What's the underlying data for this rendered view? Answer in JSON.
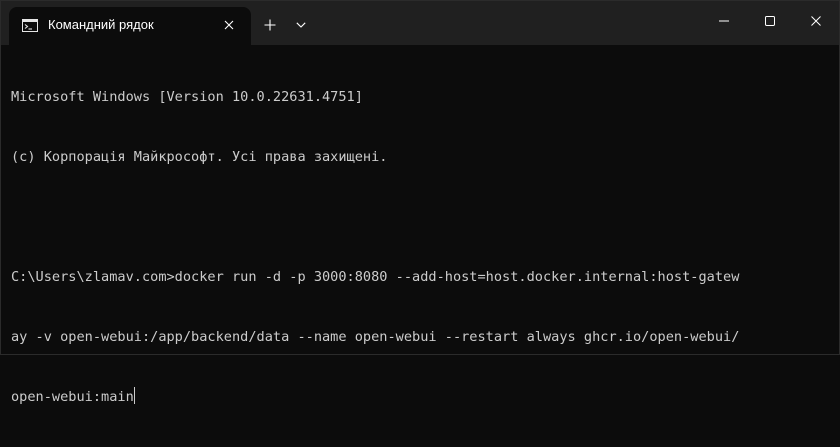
{
  "window": {
    "tab_title": "Командний рядок",
    "tab_icon": "cmd-icon",
    "controls": {
      "new_tab_icon": "plus-icon",
      "dropdown_icon": "chevron-down-icon",
      "minimize_icon": "minimize-icon",
      "maximize_icon": "maximize-icon",
      "close_icon": "close-icon"
    }
  },
  "terminal": {
    "lines": [
      "Microsoft Windows [Version 10.0.22631.4751]",
      "(c) Корпорація Майкрософт. Усі права захищені.",
      "",
      "C:\\Users\\zlamav.com>docker run -d -p 3000:8080 --add-host=host.docker.internal:host-gatew",
      "ay -v open-webui:/app/backend/data --name open-webui --restart always ghcr.io/open-webui/",
      "open-webui:main"
    ],
    "colors": {
      "background": "#0c0c0c",
      "text": "#cccccc",
      "titlebar": "#202020"
    }
  }
}
